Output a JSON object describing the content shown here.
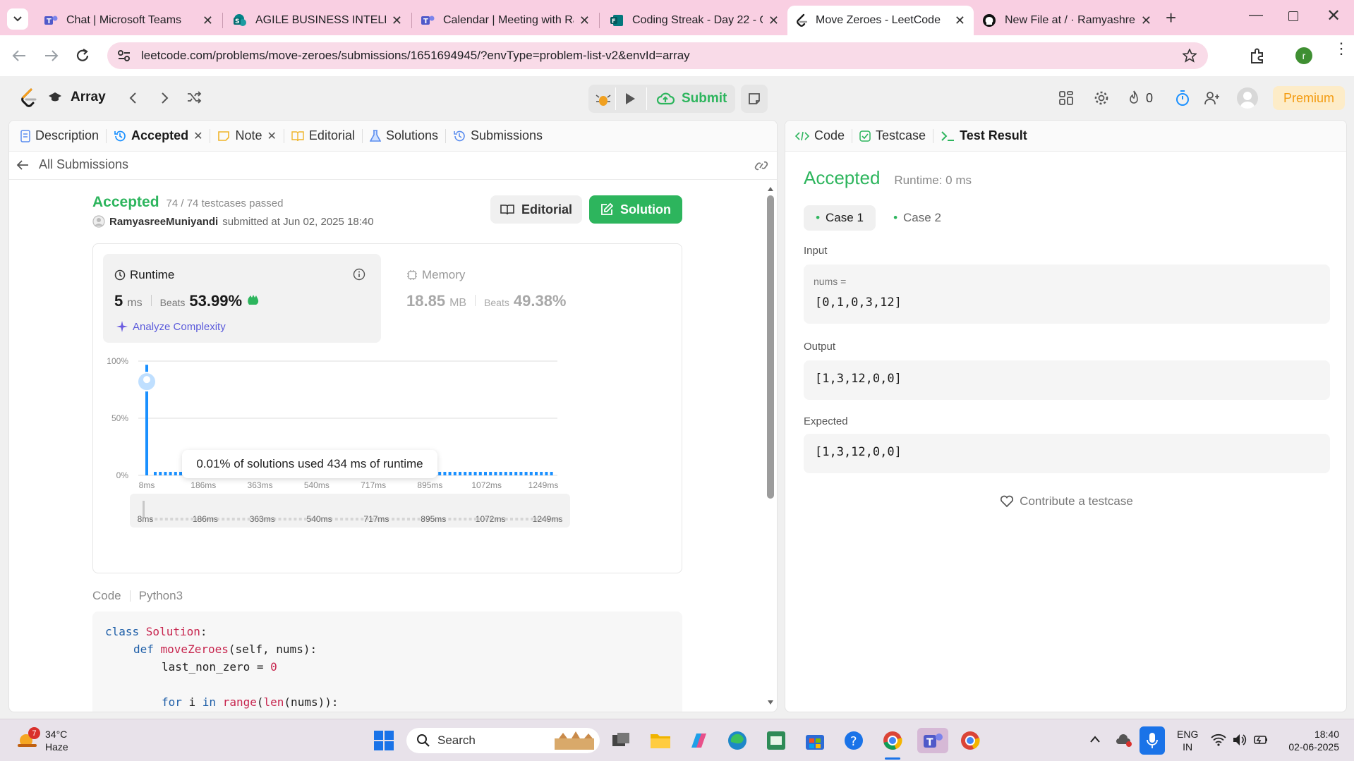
{
  "browser": {
    "tabs": [
      {
        "title": "Chat | Microsoft Teams",
        "icon": "teams-icon"
      },
      {
        "title": "AGILE BUSINESS INTELLIGE",
        "icon": "sharepoint-icon"
      },
      {
        "title": "Calendar | Meeting with Ra",
        "icon": "teams-icon"
      },
      {
        "title": "Coding Streak - Day 22 - O",
        "icon": "forms-icon"
      },
      {
        "title": "Move Zeroes - LeetCode",
        "icon": "leetcode-icon"
      },
      {
        "title": "New File at / · Ramyashree",
        "icon": "github-icon"
      }
    ],
    "url": "leetcode.com/problems/move-zeroes/submissions/1651694945/?envType=problem-list-v2&envId=array",
    "profile_initial": "r"
  },
  "nav": {
    "problem_list": "Array",
    "submit": "Submit",
    "streak": "0",
    "premium": "Premium"
  },
  "left_tabs": {
    "description": "Description",
    "accepted": "Accepted",
    "note": "Note",
    "editorial": "Editorial",
    "solutions": "Solutions",
    "submissions": "Submissions"
  },
  "back": "All Submissions",
  "submission": {
    "status": "Accepted",
    "testcases": "74 / 74 testcases passed",
    "user": "RamyasreeMuniyandi",
    "submitted": "submitted at Jun 02, 2025 18:40",
    "editorial_btn": "Editorial",
    "solution_btn": "Solution"
  },
  "runtime": {
    "label": "Runtime",
    "value": "5",
    "unit": "ms",
    "beats_label": "Beats",
    "beats": "53.99%",
    "analyze": "Analyze Complexity"
  },
  "memory": {
    "label": "Memory",
    "value": "18.85",
    "unit": "MB",
    "beats_label": "Beats",
    "beats": "49.38%"
  },
  "chart_data": {
    "type": "bar",
    "y_ticks": [
      "100%",
      "50%",
      "0%"
    ],
    "x_ticks": [
      "8ms",
      "186ms",
      "363ms",
      "540ms",
      "717ms",
      "895ms",
      "1072ms",
      "1249ms"
    ],
    "ylim": [
      0,
      100
    ],
    "highlight_x": "8ms",
    "highlight_value": 82,
    "tooltip": "0.01% of solutions used 434 ms of runtime",
    "accent": "#1a90ff"
  },
  "code": {
    "label": "Code",
    "lang": "Python3",
    "lines": [
      {
        "indent": 0,
        "parts": [
          [
            "kw",
            "class "
          ],
          [
            "cls",
            "Solution"
          ],
          [
            "p",
            ":"
          ]
        ]
      },
      {
        "indent": 1,
        "parts": [
          [
            "kw",
            "def "
          ],
          [
            "fn",
            "moveZeroes"
          ],
          [
            "p",
            "(self, nums):"
          ]
        ]
      },
      {
        "indent": 2,
        "parts": [
          [
            "p",
            "last_non_zero = "
          ],
          [
            "num",
            "0"
          ]
        ]
      },
      {
        "indent": 0,
        "parts": []
      },
      {
        "indent": 2,
        "parts": [
          [
            "kw",
            "for "
          ],
          [
            "p",
            "i "
          ],
          [
            "kw",
            "in "
          ],
          [
            "fn",
            "range"
          ],
          [
            "p",
            "("
          ],
          [
            "fn",
            "len"
          ],
          [
            "p",
            "(nums)):"
          ]
        ]
      }
    ]
  },
  "right_tabs": {
    "code": "Code",
    "testcase": "Testcase",
    "result": "Test Result"
  },
  "result": {
    "status": "Accepted",
    "runtime": "Runtime: 0 ms",
    "cases": [
      "Case 1",
      "Case 2"
    ],
    "input_label": "Input",
    "var_label": "nums =",
    "input": "[0,1,0,3,12]",
    "output_label": "Output",
    "output": "[1,3,12,0,0]",
    "expected_label": "Expected",
    "expected": "[1,3,12,0,0]",
    "contribute": "Contribute a testcase"
  },
  "taskbar": {
    "temp": "34°C",
    "weather": "Haze",
    "weather_badge": "7",
    "search": "Search",
    "lang1": "ENG",
    "lang2": "IN",
    "time": "18:40",
    "date": "02-06-2025"
  }
}
